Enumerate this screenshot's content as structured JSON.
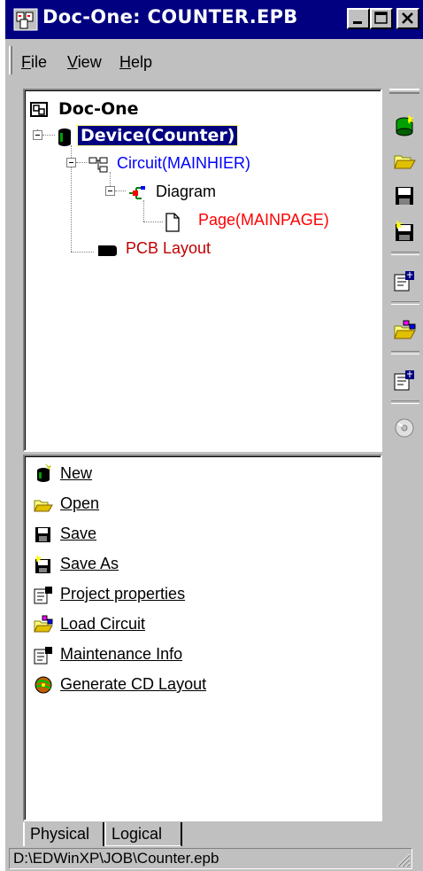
{
  "window": {
    "title": "Doc-One: COUNTER.EPB"
  },
  "menubar": {
    "items": [
      {
        "label": "File",
        "mnemonic": "F",
        "rest": "ile"
      },
      {
        "label": "View",
        "mnemonic": "V",
        "rest": "iew"
      },
      {
        "label": "Help",
        "mnemonic": "H",
        "rest": "elp"
      }
    ]
  },
  "tree": {
    "root": "Doc-One",
    "device": "Device(Counter)",
    "circuit": "Circuit(MAINHIER)",
    "diagram": "Diagram",
    "page": "Page(MAINPAGE)",
    "pcb": "PCB Layout"
  },
  "actions": [
    {
      "label": "New",
      "icon": "new-device-icon"
    },
    {
      "label": "Open",
      "icon": "open-folder-icon"
    },
    {
      "label": "Save",
      "icon": "save-disk-icon"
    },
    {
      "label": "Save As",
      "icon": "save-as-icon"
    },
    {
      "label": "Project properties",
      "icon": "properties-icon"
    },
    {
      "label": "Load Circuit",
      "icon": "load-circuit-icon"
    },
    {
      "label": "Maintenance Info",
      "icon": "maintenance-icon"
    },
    {
      "label": "Generate CD Layout",
      "icon": "cd-layout-icon"
    }
  ],
  "toolbar": {
    "buttons": [
      "new-device-icon",
      "open-folder-icon",
      "save-disk-icon",
      "save-as-icon",
      "properties-icon",
      "load-circuit-icon",
      "maintenance-icon",
      "cd-icon"
    ]
  },
  "tabs": [
    {
      "label": "Physical",
      "active": true
    },
    {
      "label": "Logical",
      "active": false
    }
  ],
  "status": {
    "path": "D:\\EDWinXP\\JOB\\Counter.epb"
  },
  "colors": {
    "titlebar": "#000080",
    "selection": "#000080",
    "circuit": "#0000ff",
    "page": "#ff0000",
    "pcb": "#c00000",
    "face": "#c0c0c0"
  }
}
